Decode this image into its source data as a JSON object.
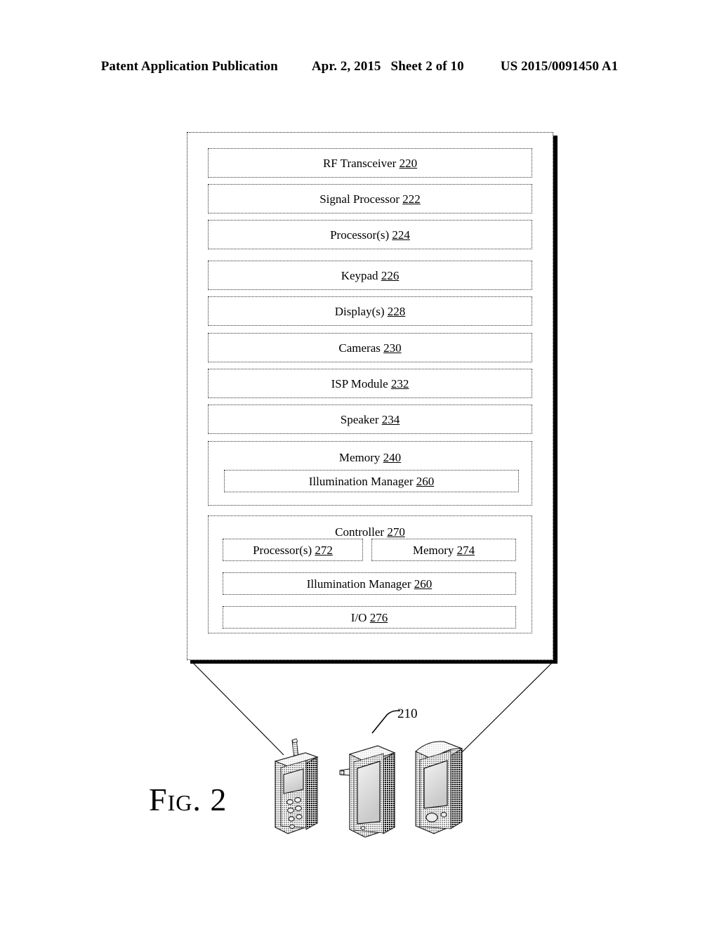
{
  "header": {
    "publication": "Patent Application Publication",
    "date": "Apr. 2, 2015",
    "sheet": "Sheet 2 of 10",
    "number": "US 2015/0091450 A1"
  },
  "figure": {
    "caption": "Fig. 2",
    "callout_label": "210"
  },
  "diagram": {
    "blocks": [
      {
        "name": "rf-transceiver",
        "label": "RF Transceiver",
        "ref": "220"
      },
      {
        "name": "signal-processor",
        "label": "Signal Processor",
        "ref": "222"
      },
      {
        "name": "processors",
        "label": "Processor(s)",
        "ref": "224"
      },
      {
        "name": "keypad",
        "label": "Keypad",
        "ref": "226"
      },
      {
        "name": "displays",
        "label": "Display(s)",
        "ref": "228"
      },
      {
        "name": "cameras",
        "label": "Cameras",
        "ref": "230"
      },
      {
        "name": "isp-module",
        "label": "ISP Module",
        "ref": "232"
      },
      {
        "name": "speaker",
        "label": "Speaker",
        "ref": "234"
      }
    ],
    "memory": {
      "label": "Memory",
      "ref": "240",
      "child": {
        "label": "Illumination Manager",
        "ref": "260"
      }
    },
    "controller": {
      "label": "Controller",
      "ref": "270",
      "children": [
        {
          "name": "controller-processors",
          "label": "Processor(s)",
          "ref": "272"
        },
        {
          "name": "controller-memory",
          "label": "Memory",
          "ref": "274"
        },
        {
          "name": "controller-illumination-manager",
          "label": "Illumination Manager",
          "ref": "260"
        },
        {
          "name": "controller-io",
          "label": "I/O",
          "ref": "276"
        }
      ]
    }
  },
  "colors": {
    "ink": "#000000",
    "paper": "#ffffff",
    "shadow": "#000000",
    "border": "#333333"
  }
}
